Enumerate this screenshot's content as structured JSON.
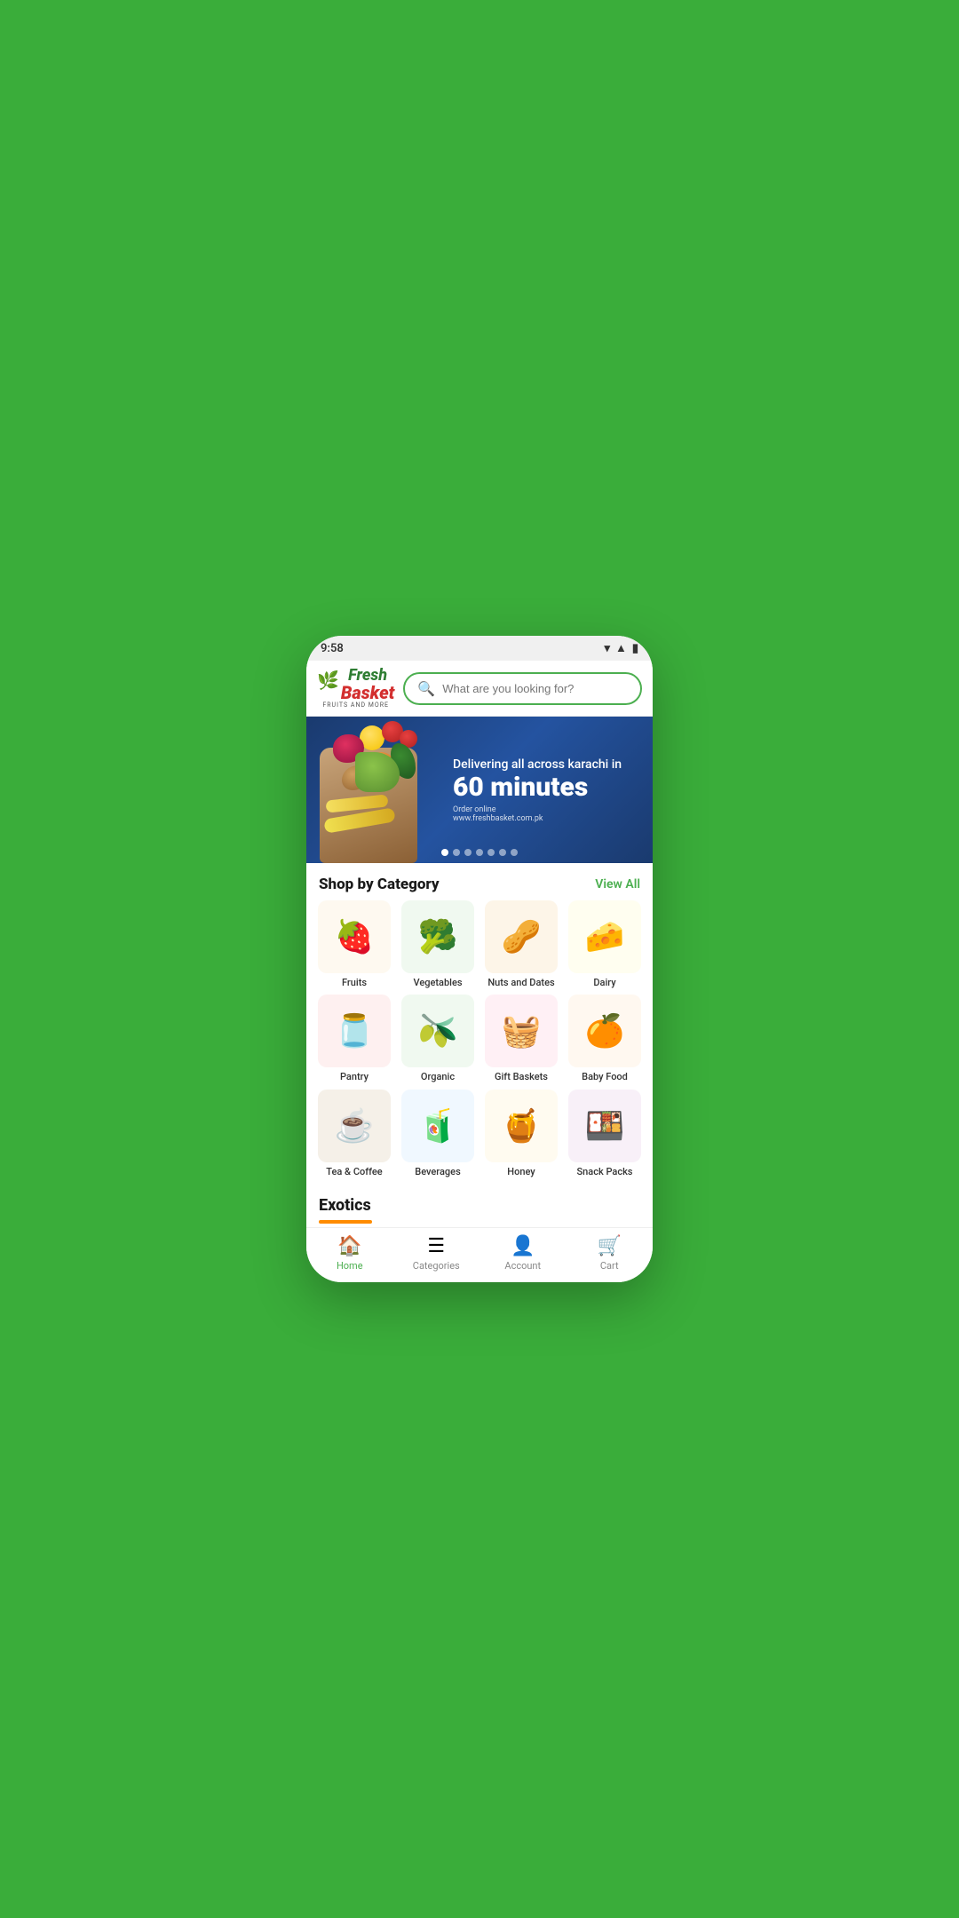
{
  "app": {
    "name": "FreshBasket",
    "tagline": "FRUITS AND MORE"
  },
  "status_bar": {
    "time": "9:58",
    "icons": [
      "wifi",
      "signal",
      "battery"
    ]
  },
  "header": {
    "logo_fresh": "Fresh",
    "logo_basket": "Basket",
    "logo_subtitle": "FRUITS AND MORE",
    "search_placeholder": "What are you looking for?"
  },
  "banner": {
    "line1": "Delivering all across karachi in",
    "line2": "60 minutes",
    "tagline": "Order online",
    "website": "www.freshbasket.com.pk",
    "dots_count": 7,
    "active_dot": 0
  },
  "shop_by_category": {
    "title": "Shop by Category",
    "view_all": "View All",
    "categories": [
      {
        "id": "fruits",
        "label": "Fruits",
        "emoji": "🍓",
        "bg_class": "cat-fruits"
      },
      {
        "id": "vegetables",
        "label": "Vegetables",
        "emoji": "🥦",
        "bg_class": "cat-veggies"
      },
      {
        "id": "nuts-dates",
        "label": "Nuts and Dates",
        "emoji": "🥜",
        "bg_class": "cat-nuts"
      },
      {
        "id": "dairy",
        "label": "Dairy",
        "emoji": "🧀",
        "bg_class": "cat-dairy"
      },
      {
        "id": "pantry",
        "label": "Pantry",
        "emoji": "🫙",
        "bg_class": "cat-pantry"
      },
      {
        "id": "organic",
        "label": "Organic",
        "emoji": "🫒",
        "bg_class": "cat-organic"
      },
      {
        "id": "gift-baskets",
        "label": "Gift Baskets",
        "emoji": "🧺",
        "bg_class": "cat-gift"
      },
      {
        "id": "baby-food",
        "label": "Baby Food",
        "emoji": "🍊",
        "bg_class": "cat-baby"
      },
      {
        "id": "tea-coffee",
        "label": "Tea & Coffee",
        "emoji": "☕",
        "bg_class": "cat-tea"
      },
      {
        "id": "beverages",
        "label": "Beverages",
        "emoji": "🧃",
        "bg_class": "cat-beverages"
      },
      {
        "id": "honey",
        "label": "Honey",
        "emoji": "🍯",
        "bg_class": "cat-honey"
      },
      {
        "id": "snack-packs",
        "label": "Snack Packs",
        "emoji": "🍱",
        "bg_class": "cat-snack"
      }
    ]
  },
  "exotics": {
    "title": "Exotics"
  },
  "bottom_nav": {
    "items": [
      {
        "id": "home",
        "label": "Home",
        "icon": "🏠",
        "active": true
      },
      {
        "id": "categories",
        "label": "Categories",
        "icon": "☰",
        "active": false
      },
      {
        "id": "account",
        "label": "Account",
        "icon": "👤",
        "active": false
      },
      {
        "id": "cart",
        "label": "Cart",
        "icon": "🛒",
        "active": false
      }
    ]
  }
}
